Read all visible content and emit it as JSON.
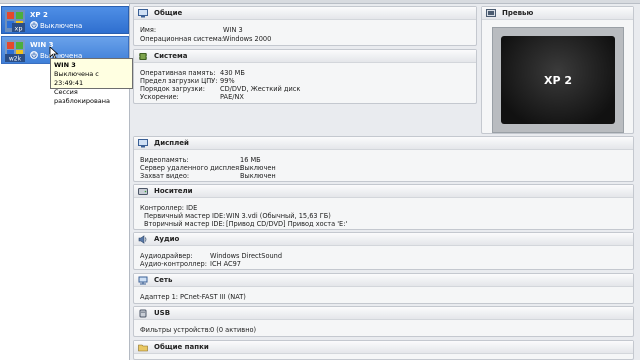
{
  "vm_list": [
    {
      "name": "XP 2",
      "state": "Выключена",
      "os_icon": "xp-os-icon",
      "os_text": "xp"
    },
    {
      "name": "WIN 3",
      "state": "Выключена",
      "os_icon": "w2k-os-icon",
      "os_text": "w2k"
    }
  ],
  "tooltip": {
    "title": "WIN 3",
    "line1": "Выключена с 23:49:41",
    "line2": "Сессия разблокирована"
  },
  "sections": {
    "general": {
      "title": "Общие",
      "name_label": "Имя:",
      "name_value": "WIN 3",
      "os_label": "Операционная система:",
      "os_value": "Windows 2000"
    },
    "system": {
      "title": "Система",
      "mem_label": "Оперативная память:",
      "mem_value": "430 МБ",
      "cpu_label": "Предел загрузки ЦПУ:",
      "cpu_value": "99%",
      "boot_label": "Порядок загрузки:",
      "boot_value": "CD/DVD, Жесткий диск",
      "accel_label": "Ускорение:",
      "accel_value": "PAE/NX"
    },
    "preview": {
      "title": "Превью",
      "screen_text": "XP 2"
    },
    "display": {
      "title": "Дисплей",
      "vram_label": "Видеопамять:",
      "vram_value": "16 МБ",
      "rdp_label": "Сервер удаленного дисплея:",
      "rdp_value": "Выключен",
      "capture_label": "Захват видео:",
      "capture_value": "Выключен"
    },
    "storage": {
      "title": "Носители",
      "controller": "Контроллер: IDE",
      "primary_label": "Первичный мастер IDE:",
      "primary_value": "WIN 3.vdi (Обычный, 15,63 ГБ)",
      "secondary_label": "Вторичный мастер IDE:",
      "secondary_value": "[Привод CD/DVD] Привод хоста 'E:'"
    },
    "audio": {
      "title": "Аудио",
      "driver_label": "Аудиодрайвер:",
      "driver_value": "Windows DirectSound",
      "ctrl_label": "Аудио-контроллер:",
      "ctrl_value": "ICH AC97"
    },
    "network": {
      "title": "Сеть",
      "adapter_label": "Адаптер 1:",
      "adapter_value": "PCnet-FAST III (NAT)"
    },
    "usb": {
      "title": "USB",
      "filters_label": "Фильтры устройств:",
      "filters_value": "0 (0 активно)"
    },
    "shared": {
      "title": "Общие папки"
    }
  },
  "colors": {
    "selection": "#2f6fcf",
    "tooltip_bg": "#ffffe1",
    "panel_bg": "#f5f6f7"
  }
}
